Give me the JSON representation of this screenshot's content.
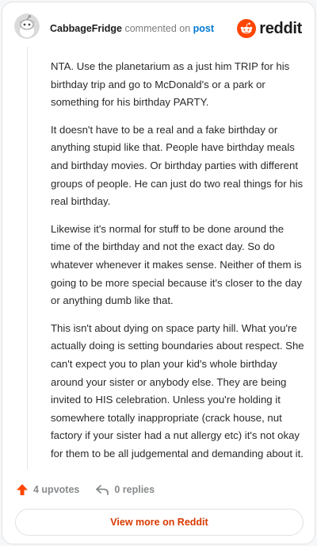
{
  "header": {
    "username": "CabbageFridge",
    "action_text": "commented on",
    "post_link": "post",
    "brand_word": "reddit"
  },
  "comment": {
    "paragraphs": [
      "NTA. Use the planetarium as a just him TRIP for his birthday trip and go to McDonald's or a park or something for his birthday PARTY.",
      "It doesn't have to be a real and a fake birthday or anything stupid like that. People have birthday meals and birthday movies. Or birthday parties with different groups of people. He can just do two real things for his real birthday.",
      "Likewise it's normal for stuff to be done around the time of the birthday and not the exact day. So do whatever whenever it makes sense. Neither of them is going to be more special because it's closer to the day or anything dumb like that.",
      "This isn't about dying on space party hill. What you're actually doing is setting boundaries about respect. She can't expect you to plan your kid's whole birthday around your sister or anybody else. They are being invited to HIS celebration. Unless you're holding it somewhere totally inappropriate (crack house, nut factory if your sister had a nut allergy etc) it's not okay for them to be all judgemental and demanding about it."
    ]
  },
  "footer": {
    "upvotes": "4 upvotes",
    "replies": "0 replies",
    "view_more": "View more on Reddit"
  },
  "colors": {
    "reddit_orange": "#ff4500",
    "link_blue": "#0079d3",
    "button_text": "#d93a00"
  },
  "icons": {
    "avatar": "snoo-avatar-icon",
    "logo": "reddit-logo-icon",
    "upvote": "upvote-arrow-icon",
    "reply": "reply-arrow-icon"
  }
}
